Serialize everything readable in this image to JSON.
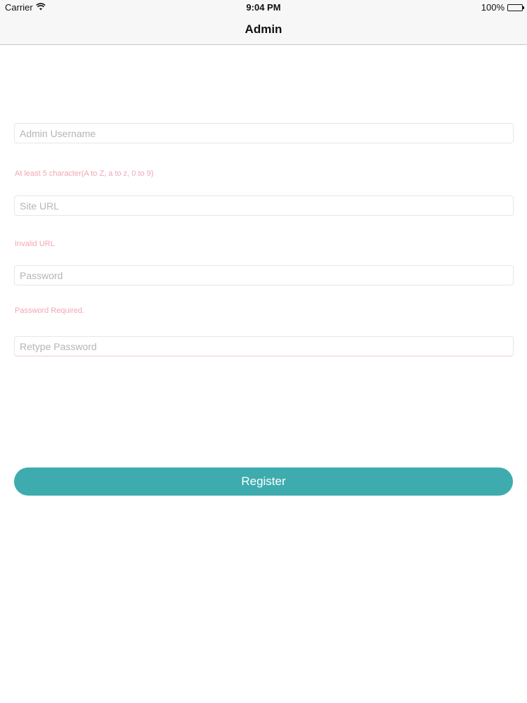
{
  "status_bar": {
    "carrier": "Carrier",
    "time": "9:04 PM",
    "battery_percent": "100%",
    "battery_level": 1.0,
    "wifi_icon": "wifi-icon",
    "battery_icon": "battery-icon"
  },
  "nav": {
    "title": "Admin"
  },
  "form": {
    "username": {
      "placeholder": "Admin Username",
      "value": ""
    },
    "username_hint": "At least 5 character(A to Z, a to z, 0 to 9)",
    "site_url": {
      "placeholder": "Site URL",
      "value": ""
    },
    "site_url_hint": "Invalid URL",
    "password": {
      "placeholder": "Password",
      "value": ""
    },
    "password_hint": "Password Required.",
    "retype_password": {
      "placeholder": "Retype Password",
      "value": ""
    },
    "register_label": "Register"
  },
  "colors": {
    "accent": "#3eacae",
    "error_hint": "#f2a5b5",
    "nav_background": "#f7f7f8"
  }
}
